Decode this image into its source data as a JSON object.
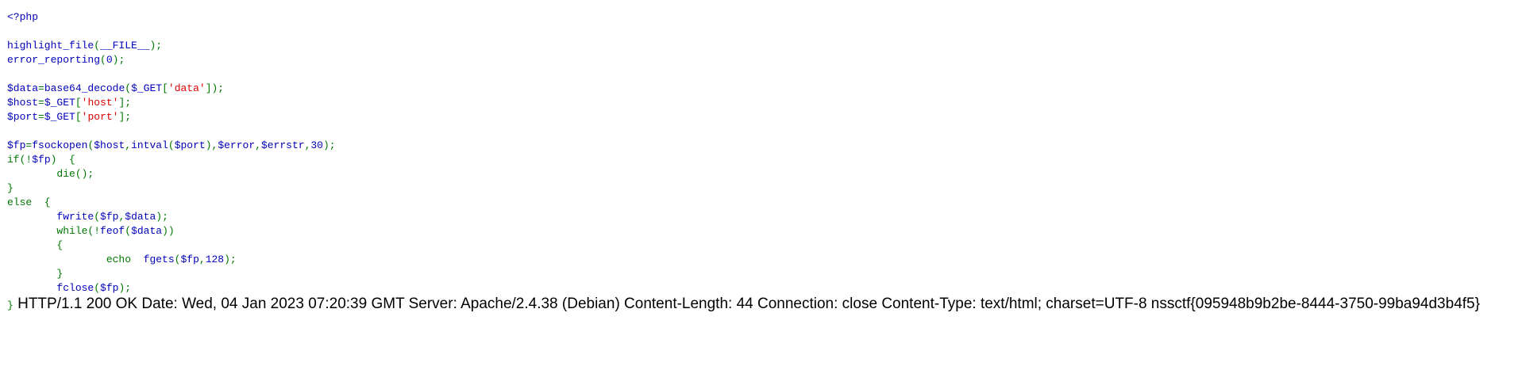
{
  "colors": {
    "default": "#0000BB",
    "keyword": "#007700",
    "string": "#DD0000",
    "html": "#000000",
    "background": "#ffffff"
  },
  "source_lines": [
    [
      {
        "t": "<?php",
        "c": "default"
      }
    ],
    [],
    [
      {
        "t": "highlight_file",
        "c": "default"
      },
      {
        "t": "(",
        "c": "keyword"
      },
      {
        "t": "__FILE__",
        "c": "default"
      },
      {
        "t": ");",
        "c": "keyword"
      }
    ],
    [
      {
        "t": "error_reporting",
        "c": "default"
      },
      {
        "t": "(",
        "c": "keyword"
      },
      {
        "t": "0",
        "c": "default"
      },
      {
        "t": ");",
        "c": "keyword"
      }
    ],
    [],
    [
      {
        "t": "$data",
        "c": "default"
      },
      {
        "t": "=",
        "c": "keyword"
      },
      {
        "t": "base64_decode",
        "c": "default"
      },
      {
        "t": "(",
        "c": "keyword"
      },
      {
        "t": "$_GET",
        "c": "default"
      },
      {
        "t": "[",
        "c": "keyword"
      },
      {
        "t": "'data'",
        "c": "string"
      },
      {
        "t": "]);",
        "c": "keyword"
      }
    ],
    [
      {
        "t": "$host",
        "c": "default"
      },
      {
        "t": "=",
        "c": "keyword"
      },
      {
        "t": "$_GET",
        "c": "default"
      },
      {
        "t": "[",
        "c": "keyword"
      },
      {
        "t": "'host'",
        "c": "string"
      },
      {
        "t": "];",
        "c": "keyword"
      }
    ],
    [
      {
        "t": "$port",
        "c": "default"
      },
      {
        "t": "=",
        "c": "keyword"
      },
      {
        "t": "$_GET",
        "c": "default"
      },
      {
        "t": "[",
        "c": "keyword"
      },
      {
        "t": "'port'",
        "c": "string"
      },
      {
        "t": "];",
        "c": "keyword"
      }
    ],
    [],
    [
      {
        "t": "$fp",
        "c": "default"
      },
      {
        "t": "=",
        "c": "keyword"
      },
      {
        "t": "fsockopen",
        "c": "default"
      },
      {
        "t": "(",
        "c": "keyword"
      },
      {
        "t": "$host",
        "c": "default"
      },
      {
        "t": ",",
        "c": "keyword"
      },
      {
        "t": "intval",
        "c": "default"
      },
      {
        "t": "(",
        "c": "keyword"
      },
      {
        "t": "$port",
        "c": "default"
      },
      {
        "t": "),",
        "c": "keyword"
      },
      {
        "t": "$error",
        "c": "default"
      },
      {
        "t": ",",
        "c": "keyword"
      },
      {
        "t": "$errstr",
        "c": "default"
      },
      {
        "t": ",",
        "c": "keyword"
      },
      {
        "t": "30",
        "c": "default"
      },
      {
        "t": ");",
        "c": "keyword"
      }
    ],
    [
      {
        "t": "if(!",
        "c": "keyword"
      },
      {
        "t": "$fp",
        "c": "default"
      },
      {
        "t": ")  {",
        "c": "keyword"
      }
    ],
    [
      {
        "t": "        die();",
        "c": "keyword"
      }
    ],
    [
      {
        "t": "}",
        "c": "keyword"
      }
    ],
    [
      {
        "t": "else  {",
        "c": "keyword"
      }
    ],
    [
      {
        "t": "        ",
        "c": "keyword"
      },
      {
        "t": "fwrite",
        "c": "default"
      },
      {
        "t": "(",
        "c": "keyword"
      },
      {
        "t": "$fp",
        "c": "default"
      },
      {
        "t": ",",
        "c": "keyword"
      },
      {
        "t": "$data",
        "c": "default"
      },
      {
        "t": ");",
        "c": "keyword"
      }
    ],
    [
      {
        "t": "        while(!",
        "c": "keyword"
      },
      {
        "t": "feof",
        "c": "default"
      },
      {
        "t": "(",
        "c": "keyword"
      },
      {
        "t": "$data",
        "c": "default"
      },
      {
        "t": "))",
        "c": "keyword"
      }
    ],
    [
      {
        "t": "        {",
        "c": "keyword"
      }
    ],
    [
      {
        "t": "                echo  ",
        "c": "keyword"
      },
      {
        "t": "fgets",
        "c": "default"
      },
      {
        "t": "(",
        "c": "keyword"
      },
      {
        "t": "$fp",
        "c": "default"
      },
      {
        "t": ",",
        "c": "keyword"
      },
      {
        "t": "128",
        "c": "default"
      },
      {
        "t": ");",
        "c": "keyword"
      }
    ],
    [
      {
        "t": "        }",
        "c": "keyword"
      }
    ],
    [
      {
        "t": "        ",
        "c": "keyword"
      },
      {
        "t": "fclose",
        "c": "default"
      },
      {
        "t": "(",
        "c": "keyword"
      },
      {
        "t": "$fp",
        "c": "default"
      },
      {
        "t": ");",
        "c": "keyword"
      }
    ]
  ],
  "closing_brace": "}",
  "response_output": "HTTP/1.1 200 OK Date: Wed, 04 Jan 2023 07:20:39 GMT Server: Apache/2.4.38 (Debian) Content-Length: 44 Connection: close Content-Type: text/html; charset=UTF-8 nssctf{095948b9b2be-8444-3750-99ba94d3b4f5}"
}
